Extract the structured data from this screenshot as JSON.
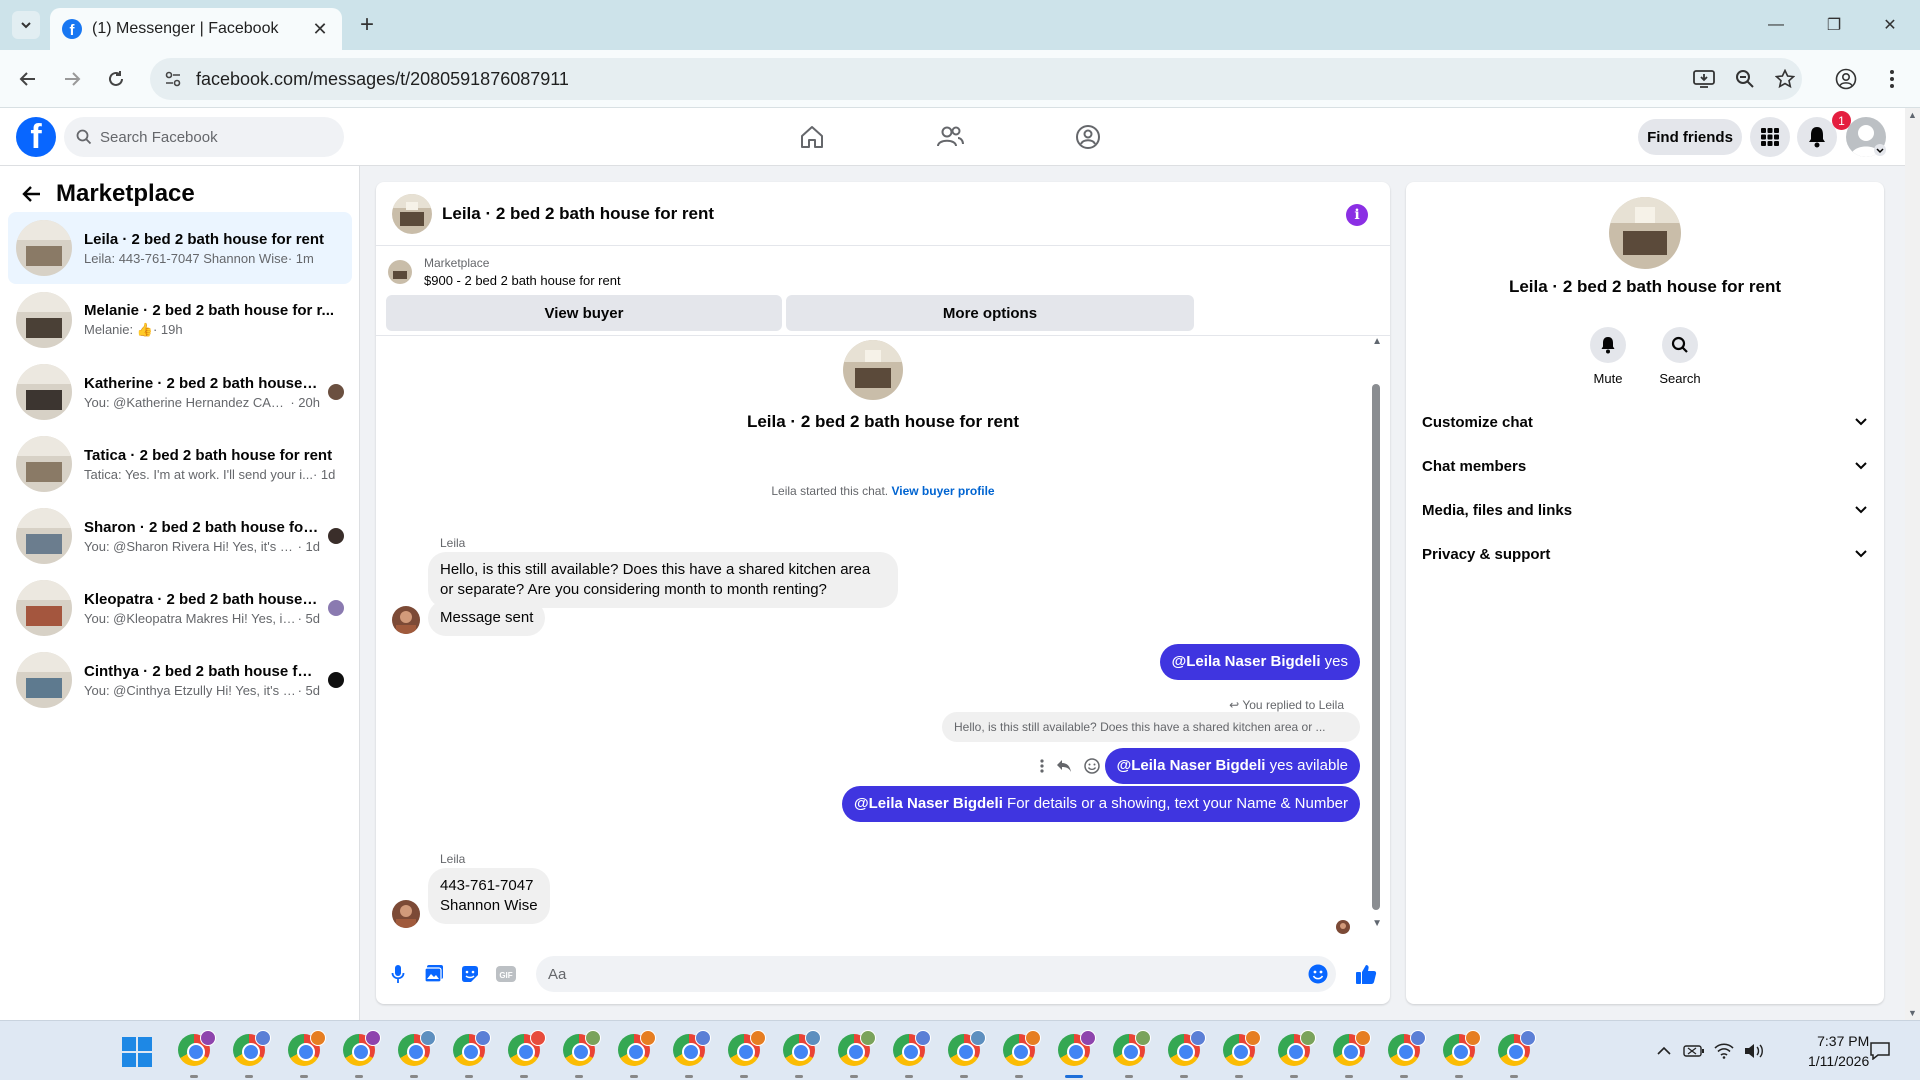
{
  "browser": {
    "tab_title": "(1) Messenger | Facebook",
    "url": "facebook.com/messages/t/2080591876087911"
  },
  "fb_nav": {
    "search_placeholder": "Search Facebook",
    "find_friends": "Find friends",
    "notification_count": "1"
  },
  "sidebar": {
    "title": "Marketplace",
    "conversations": [
      {
        "name": "Leila · 2 bed 2 bath house for rent",
        "snippet": "Leila: 443-761-7047 Shannon Wise",
        "time": " · 1m",
        "thumb": "#8a7a66"
      },
      {
        "name": "Melanie · 2 bed 2 bath house for r...",
        "snippet": "Melanie: 👍",
        "time": " · 19h",
        "thumb": "#4a4036"
      },
      {
        "name": "Katherine · 2 bed 2 bath house f...",
        "snippet": "You: @Katherine Hernandez CALL...",
        "time": " · 20h",
        "thumb": "#3c3530"
      },
      {
        "name": "Tatica · 2 bed 2 bath house for rent",
        "snippet": "Tatica: Yes. I'm at work. I'll send your i...",
        "time": " · 1d",
        "thumb": "#8a7a66"
      },
      {
        "name": "Sharon · 2 bed 2 bath house for ...",
        "snippet": "You: @Sharon Rivera Hi! Yes, it's stil...",
        "time": " · 1d",
        "thumb": "#6b7d8e"
      },
      {
        "name": "Kleopatra · 2 bed 2 bath house f...",
        "snippet": "You: @Kleopatra Makres Hi! Yes, it'...",
        "time": " · 5d",
        "thumb": "#a4563e"
      },
      {
        "name": "Cinthya · 2 bed 2 bath house for...",
        "snippet": "You: @Cinthya Etzully Hi! Yes, it's st...",
        "time": " · 5d",
        "thumb": "#5e7a8f"
      }
    ]
  },
  "chat": {
    "title": "Leila · 2 bed 2 bath house for rent",
    "marketplace_label": "Marketplace",
    "listing": "$900 - 2 bed 2 bath house for rent",
    "view_buyer": "View buyer",
    "more_options": "More options",
    "intro_title": "Leila · 2 bed 2 bath house for rent",
    "started_text": "Leila started this chat.",
    "view_buyer_profile": "View buyer profile",
    "sender_name": "Leila",
    "msg1": "Hello, is this still available? Does this have a shared kitchen area or separate? Are you considering month to month renting?",
    "msg2": "Message sent",
    "out1_mention": "@Leila Naser Bigdeli",
    "out1_text": " yes",
    "reply_note": "You replied to Leila",
    "quoted": "Hello, is this still available? Does this have a shared kitchen area or ...",
    "out2_mention": "@Leila Naser Bigdeli",
    "out2_text": " yes avilable",
    "out3_mention": "@Leila Naser Bigdeli",
    "out3_text": " For details or a showing, text your Name & Number",
    "sender_name2": "Leila",
    "msg3_line1": "443-761-7047",
    "msg3_line2": "Shannon Wise",
    "composer_placeholder": "Aa"
  },
  "info_panel": {
    "title": "Leila · 2 bed 2 bath house for rent",
    "mute": "Mute",
    "search": "Search",
    "sections": [
      "Customize chat",
      "Chat members",
      "Media, files and links",
      "Privacy & support"
    ]
  },
  "taskbar": {
    "time": "7:37 PM",
    "date": "1/11/2026"
  },
  "colors": {
    "accent": "#0866ff",
    "outgoing_bubble": "#3f35e0",
    "info_icon": "#8b2fe4",
    "badge": "#e41e3f"
  }
}
